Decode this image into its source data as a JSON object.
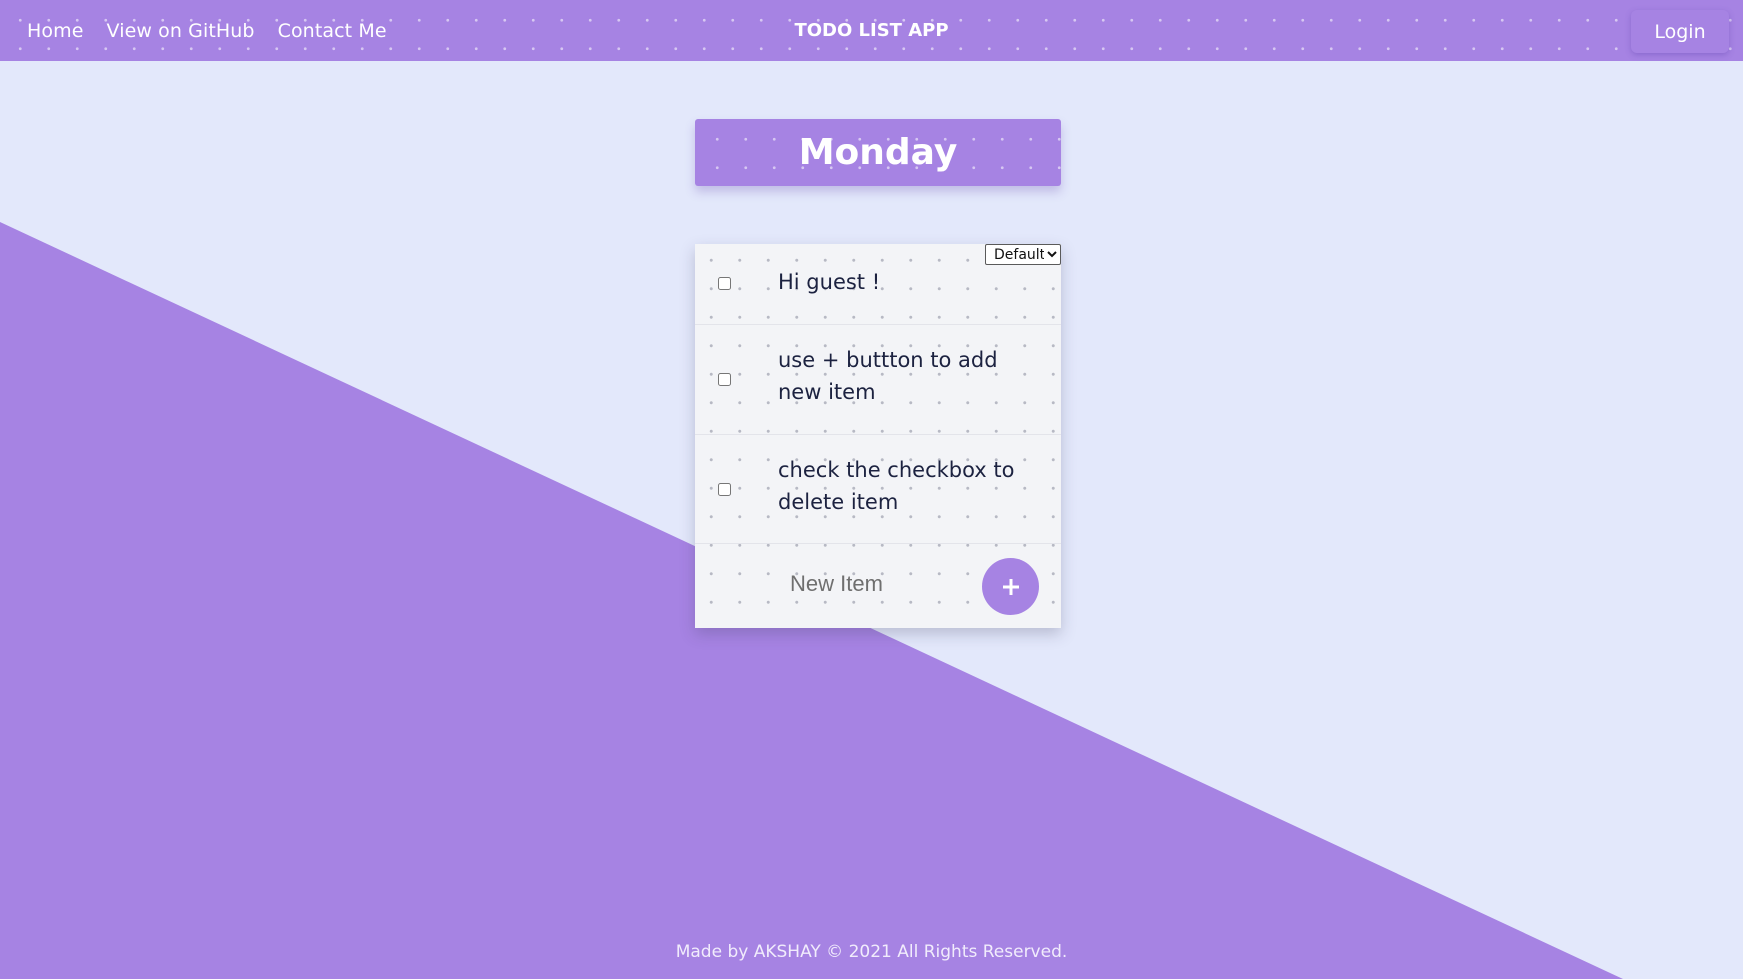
{
  "navbar": {
    "links": [
      {
        "label": "Home"
      },
      {
        "label": "View on GitHub"
      },
      {
        "label": "Contact Me"
      }
    ],
    "title": "TODO LIST APP",
    "login_label": "Login"
  },
  "day": {
    "title": "Monday"
  },
  "sort": {
    "selected": "Default"
  },
  "items": [
    {
      "text": "Hi guest !",
      "checked": false
    },
    {
      "text": "use + buttton to add new item",
      "checked": false
    },
    {
      "text": "check the checkbox to delete item",
      "checked": false
    }
  ],
  "new_item": {
    "placeholder": "New Item",
    "add_icon": "plus-icon"
  },
  "footer": {
    "text": "Made by AKSHAY © 2021 All Rights Reserved."
  },
  "colors": {
    "accent": "#a683e3",
    "background": "#e3e8fb",
    "card": "#f3f4f7",
    "item_text": "#1c2240"
  }
}
